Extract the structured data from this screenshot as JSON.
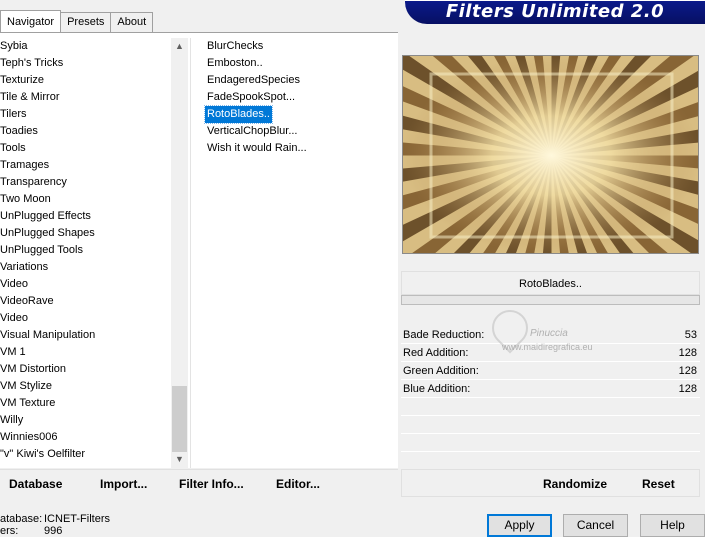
{
  "tabs": [
    {
      "label": "Navigator",
      "active": true
    },
    {
      "label": "Presets",
      "active": false
    },
    {
      "label": "About",
      "active": false
    }
  ],
  "title": "Filters Unlimited 2.0",
  "categories": [
    "Sybia",
    "Teph's Tricks",
    "Texturize",
    "Tile & Mirror",
    "Tilers",
    "Toadies",
    "Tools",
    "Tramages",
    "Transparency",
    "Two Moon",
    "UnPlugged Effects",
    "UnPlugged Shapes",
    "UnPlugged Tools",
    "Variations",
    "Video",
    "VideoRave",
    "Video",
    "Visual Manipulation",
    "VM 1",
    "VM Distortion",
    "VM Stylize",
    "VM Texture",
    "Willy",
    "Winnies006",
    "\"v\" Kiwi's Oelfilter"
  ],
  "filters": [
    {
      "label": "BlurChecks",
      "selected": false
    },
    {
      "label": "Emboston..",
      "selected": false
    },
    {
      "label": "EndageredSpecies",
      "selected": false
    },
    {
      "label": "FadeSpookSpot...",
      "selected": false
    },
    {
      "label": "RotoBlades..",
      "selected": true
    },
    {
      "label": "VerticalChopBlur...",
      "selected": false
    },
    {
      "label": "Wish it would Rain...",
      "selected": false
    }
  ],
  "selected_filter": "RotoBlades..",
  "params": [
    {
      "label": "Bade Reduction:",
      "value": "53"
    },
    {
      "label": "Red Addition:",
      "value": "128"
    },
    {
      "label": "Green Addition:",
      "value": "128"
    },
    {
      "label": "Blue Addition:",
      "value": "128"
    }
  ],
  "watermark": {
    "name": "Pinuccia",
    "url": "www.maidiregrafica.eu"
  },
  "left_buttons": {
    "database": "Database",
    "import": "Import...",
    "filter_info": "Filter Info...",
    "editor": "Editor..."
  },
  "right_buttons": {
    "randomize": "Randomize",
    "reset": "Reset"
  },
  "status": {
    "database_label": "atabase:",
    "database_value": "ICNET-Filters",
    "filters_label": "ers:",
    "filters_value": "996"
  },
  "dialog_buttons": {
    "apply": "Apply",
    "cancel": "Cancel",
    "help": "Help"
  },
  "icons": {
    "scroll_up": "chevron-up-icon",
    "scroll_down": "chevron-down-icon"
  },
  "colors": {
    "selection": "#0078d7",
    "banner": "#0b1a8c",
    "preview_light": "#f6ecc4",
    "preview_dark": "#5a3e1c"
  }
}
